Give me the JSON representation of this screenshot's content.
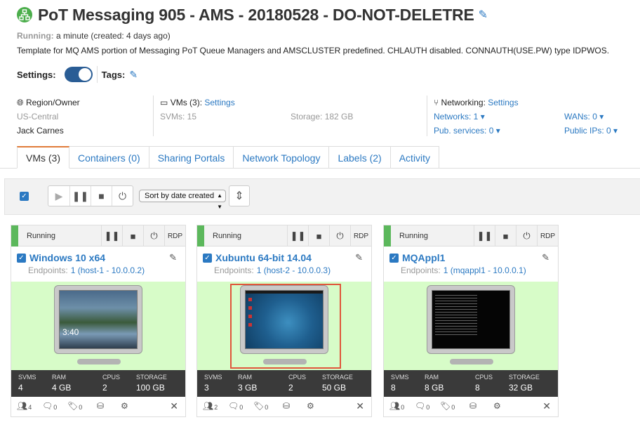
{
  "header": {
    "title": "PoT Messaging 905 - AMS - 20180528 - DO-NOT-DELETRE",
    "status_label": "Running:",
    "status_text": "a minute (created: 4 days ago)",
    "description": "Template for MQ AMS portion of Messaging PoT Queue Managers and AMSCLUSTER predefined. CHLAUTH disabled. CONNAUTH(USE.PW) type IDPWOS.",
    "settings_label": "Settings:",
    "tags_label": "Tags:"
  },
  "info": {
    "region_label": "Region/Owner",
    "region": "US-Central",
    "owner": "Jack Carnes",
    "vms_label": "VMs (3):",
    "vms_settings": "Settings",
    "svms": "SVMs: 15",
    "storage": "Storage: 182 GB",
    "networking_label": "Networking:",
    "networking_settings": "Settings",
    "networks": "Networks: 1",
    "pub_services": "Pub. services: 0",
    "wans": "WANs: 0",
    "public_ips": "Public IPs: 0"
  },
  "tabs": [
    "VMs (3)",
    "Containers (0)",
    "Sharing Portals",
    "Network Topology",
    "Labels (2)",
    "Activity"
  ],
  "toolbar": {
    "sort_value": "Sort by date created"
  },
  "vms": [
    {
      "status": "Running",
      "rdp": "RDP",
      "name": "Windows 10 x64",
      "endpoints_label": "Endpoints:",
      "endpoints": "1 (host-1 - 10.0.0.2)",
      "svms_label": "SVMS",
      "svms": "4",
      "ram_label": "RAM",
      "ram": "4 GB",
      "cpus_label": "CPUS",
      "cpus": "2",
      "storage_label": "STORAGE",
      "storage": "100 GB",
      "users": "4",
      "comments": "0",
      "tags": "0",
      "screen_time": "3:40"
    },
    {
      "status": "Running",
      "rdp": "RDP",
      "name": "Xubuntu 64-bit 14.04",
      "endpoints_label": "Endpoints:",
      "endpoints": "1 (host-2 - 10.0.0.3)",
      "svms_label": "SVMS",
      "svms": "3",
      "ram_label": "RAM",
      "ram": "3 GB",
      "cpus_label": "CPUS",
      "cpus": "2",
      "storage_label": "STORAGE",
      "storage": "50 GB",
      "users": "2",
      "comments": "0",
      "tags": "0"
    },
    {
      "status": "Running",
      "rdp": "RDP",
      "name": "MQAppl1",
      "endpoints_label": "Endpoints:",
      "endpoints": "1 (mqappl1 - 10.0.0.1)",
      "svms_label": "SVMS",
      "svms": "8",
      "ram_label": "RAM",
      "ram": "8 GB",
      "cpus_label": "CPUS",
      "cpus": "8",
      "storage_label": "STORAGE",
      "storage": "32 GB",
      "users": "0",
      "comments": "0",
      "tags": "0"
    }
  ],
  "colors": {
    "accent": "#2b79c2",
    "running": "#5cb85c",
    "screen_bg": "#d7fcc8",
    "tab_active": "#e07b39",
    "highlight": "#e0553b"
  }
}
